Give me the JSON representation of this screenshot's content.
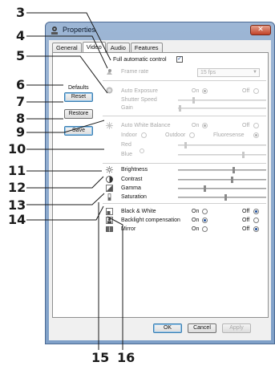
{
  "window": {
    "title": "Properties",
    "close_glyph": "✕"
  },
  "tabs": [
    "General",
    "Video",
    "Audio",
    "Features"
  ],
  "active_tab": "Video",
  "callouts": [
    "3",
    "4",
    "5",
    "6",
    "7",
    "8",
    "9",
    "10",
    "11",
    "12",
    "13",
    "14",
    "15",
    "16"
  ],
  "automatic": {
    "label": "Full automatic control",
    "checked": true
  },
  "frame_rate": {
    "label": "Frame rate",
    "value": "15 fps"
  },
  "defaults": {
    "label": "Defaults",
    "reset": "Reset",
    "restore": "Restore",
    "save": "Save"
  },
  "exposure": {
    "label": "Auto Exposure",
    "on": "On",
    "off": "Off",
    "shutter": "Shutter Speed",
    "gain": "Gain",
    "selected": "On"
  },
  "white_balance": {
    "label": "Auto White Balance",
    "on": "On",
    "off": "Off",
    "indoor": "Indoor",
    "outdoor": "Outdoor",
    "fluorescent": "Fluoresense",
    "red": "Red",
    "blue": "Blue",
    "selected": "On",
    "mode": "Fluoresense"
  },
  "sliders": {
    "brightness": "Brightness",
    "contrast": "Contrast",
    "gamma": "Gamma",
    "saturation": "Saturation"
  },
  "toggles": {
    "bw": {
      "label": "Black & White",
      "on": "On",
      "off": "Off",
      "selected": "Off"
    },
    "backlight": {
      "label": "Backlight compensation",
      "on": "On",
      "off": "Off",
      "selected": "On"
    },
    "mirror": {
      "label": "Mirror",
      "on": "On",
      "off": "Off",
      "selected": "Off"
    }
  },
  "footer": {
    "ok": "OK",
    "cancel": "Cancel",
    "apply": "Apply"
  },
  "colors": {
    "accent": "#1e4e9a",
    "titlebar": "#9db6d5",
    "close": "#c2432a"
  },
  "icons": [
    "camera-icon",
    "sun-icon",
    "white-balance-icon",
    "brightness-icon",
    "contrast-icon",
    "gamma-icon",
    "saturation-icon",
    "black-white-icon",
    "backlight-icon",
    "mirror-icon"
  ]
}
